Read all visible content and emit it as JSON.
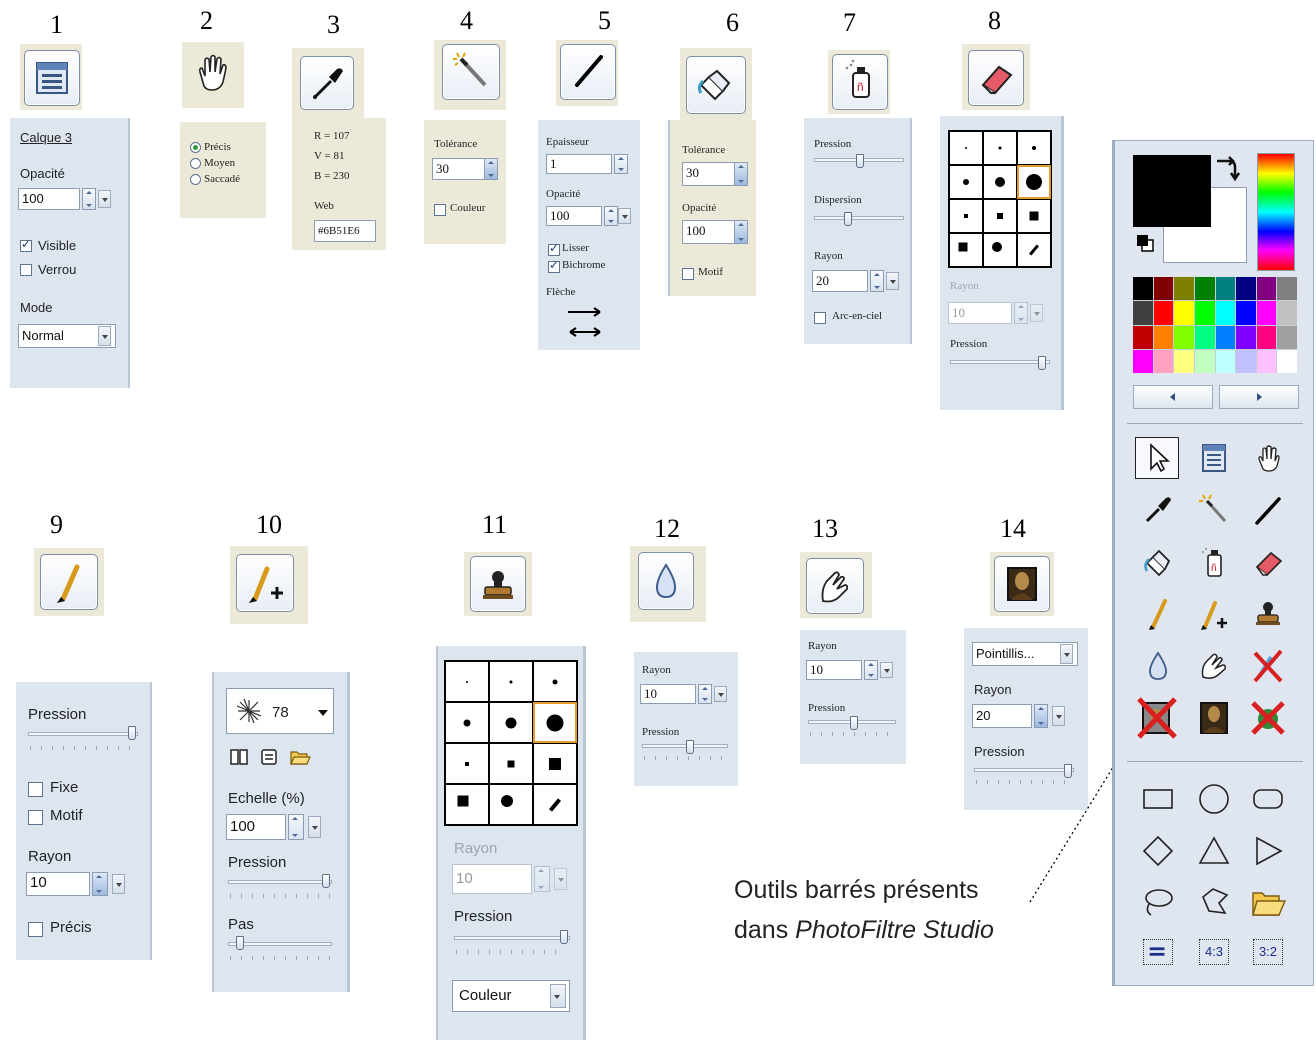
{
  "numbers": [
    "1",
    "2",
    "3",
    "4",
    "5",
    "6",
    "7",
    "8",
    "9",
    "10",
    "11",
    "12",
    "13",
    "14"
  ],
  "p1": {
    "layer": "Calque 3",
    "opacity_label": "Opacité",
    "opacity": "100",
    "visible": "Visible",
    "lock": "Verrou",
    "mode_label": "Mode",
    "mode": "Normal"
  },
  "p2": {
    "options": [
      "Précis",
      "Moyen",
      "Saccadé"
    ],
    "selected": 0
  },
  "p3": {
    "r": "R = 107",
    "v": "V = 81",
    "b": "B = 230",
    "web_label": "Web",
    "web": "#6B51E6"
  },
  "p4": {
    "tolerance_label": "Tolérance",
    "tolerance": "30",
    "color": "Couleur"
  },
  "p5": {
    "thickness_label": "Epaisseur",
    "thickness": "1",
    "opacity_label": "Opacité",
    "opacity": "100",
    "smooth": "Lisser",
    "bichrome": "Bichrome",
    "arrow_label": "Flèche"
  },
  "p6": {
    "tolerance_label": "Tolérance",
    "tolerance": "30",
    "opacity_label": "Opacité",
    "opacity": "100",
    "pattern": "Motif"
  },
  "p7": {
    "pressure_label": "Pression",
    "dispersion_label": "Dispersion",
    "radius_label": "Rayon",
    "radius": "20",
    "rainbow": "Arc-en-ciel"
  },
  "p8": {
    "radius_label": "Rayon",
    "radius": "10",
    "pressure_label": "Pression"
  },
  "p9": {
    "pressure_label": "Pression",
    "fixed": "Fixe",
    "pattern": "Motif",
    "radius_label": "Rayon",
    "radius": "10",
    "precise": "Précis"
  },
  "p10": {
    "brush_size": "78",
    "scale_label": "Echelle (%)",
    "scale": "100",
    "pressure_label": "Pression",
    "step_label": "Pas"
  },
  "p11": {
    "radius_label": "Rayon",
    "radius": "10",
    "pressure_label": "Pression",
    "mode": "Couleur"
  },
  "p12": {
    "radius_label": "Rayon",
    "radius": "10",
    "pressure_label": "Pression"
  },
  "p13": {
    "radius_label": "Rayon",
    "radius": "10",
    "pressure_label": "Pression"
  },
  "p14": {
    "effect": "Pointillis...",
    "radius_label": "Rayon",
    "radius": "20",
    "pressure_label": "Pression"
  },
  "note": {
    "line1": "Outils barrés présents",
    "line2_prefix": "dans ",
    "line2_italic": "PhotoFiltre Studio"
  },
  "palette": {
    "foreground": "#000000",
    "background": "#ffffff",
    "colors": [
      [
        "#000000",
        "#800000",
        "#808000",
        "#008000",
        "#008080",
        "#000080",
        "#800080",
        "#808080"
      ],
      [
        "#404040",
        "#ff0000",
        "#ffff00",
        "#00ff00",
        "#00ffff",
        "#0000ff",
        "#ff00ff",
        "#c0c0c0"
      ],
      [
        "#c00000",
        "#ff8000",
        "#80ff00",
        "#00ff80",
        "#0080ff",
        "#8000ff",
        "#ff0080",
        "#a0a0a0"
      ],
      [
        "#ff00ff",
        "#ffa0c0",
        "#ffff80",
        "#c0ffc0",
        "#c0ffff",
        "#c0c0ff",
        "#ffc0ff",
        "#ffffff"
      ]
    ]
  },
  "toolbar_tools": [
    "pointer",
    "layer-manager",
    "hand",
    "eyedropper",
    "magic-wand",
    "line",
    "paint-bucket",
    "spray",
    "eraser",
    "brush",
    "advanced-brush",
    "clone-stamp",
    "blur-drop",
    "smudge-finger",
    "crossed-tool-1",
    "crossed-tool-2",
    "portrait-effect",
    "crossed-tool-3"
  ],
  "shape_tools": [
    "rectangle",
    "ellipse",
    "rounded-rectangle",
    "diamond",
    "triangle",
    "right-triangle",
    "lasso",
    "polygon-lasso",
    "open-folder",
    "selection-line",
    "ratio-4-3",
    "ratio-3-2"
  ],
  "ratio_labels": [
    "4:3",
    "3:2"
  ]
}
